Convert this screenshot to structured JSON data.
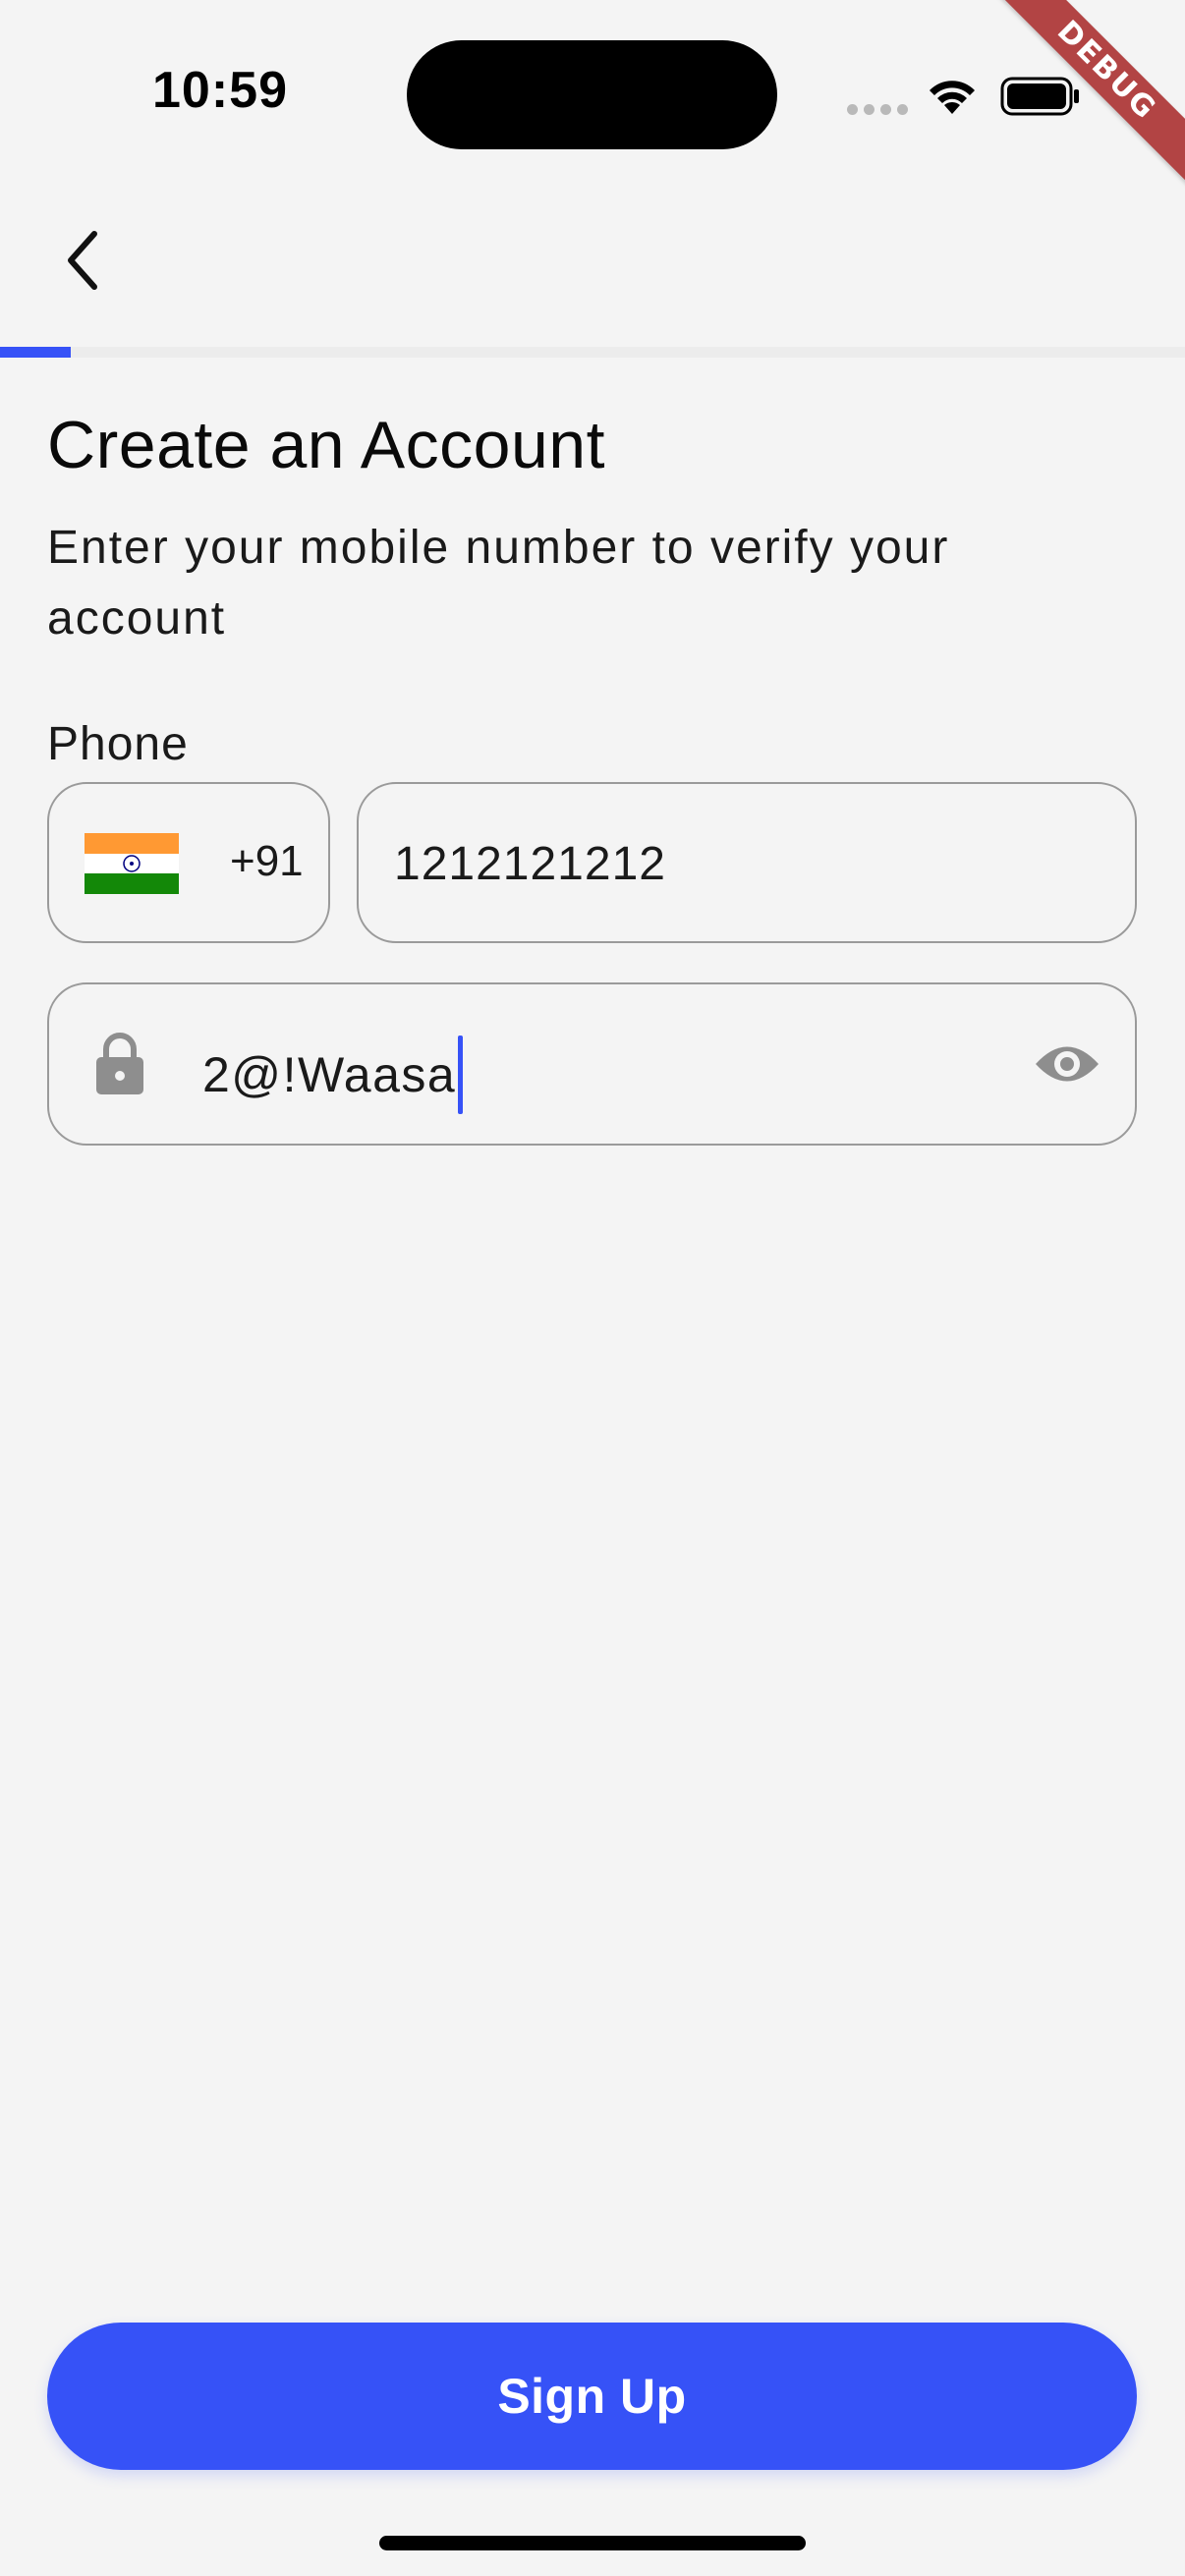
{
  "status_bar": {
    "time": "10:59",
    "debug_label": "DEBUG"
  },
  "progress": {
    "fraction": 0.06,
    "color": "#3652f7"
  },
  "header": {
    "back_icon": "chevron-left-icon"
  },
  "main": {
    "title": "Create an Account",
    "subtitle": "Enter your mobile number to verify your account",
    "phone_label": "Phone",
    "country": {
      "flag": "india-flag-icon",
      "dial_code": "+91"
    },
    "phone_value": "1212121212",
    "password": {
      "value": "2@!Waasa",
      "lock_icon": "lock-icon",
      "visibility_icon": "eye-icon"
    }
  },
  "footer": {
    "signup_label": "Sign Up"
  },
  "colors": {
    "accent": "#3652f7",
    "background": "#f4f4f4",
    "border": "#9a9a9a",
    "debug": "#b24444"
  }
}
